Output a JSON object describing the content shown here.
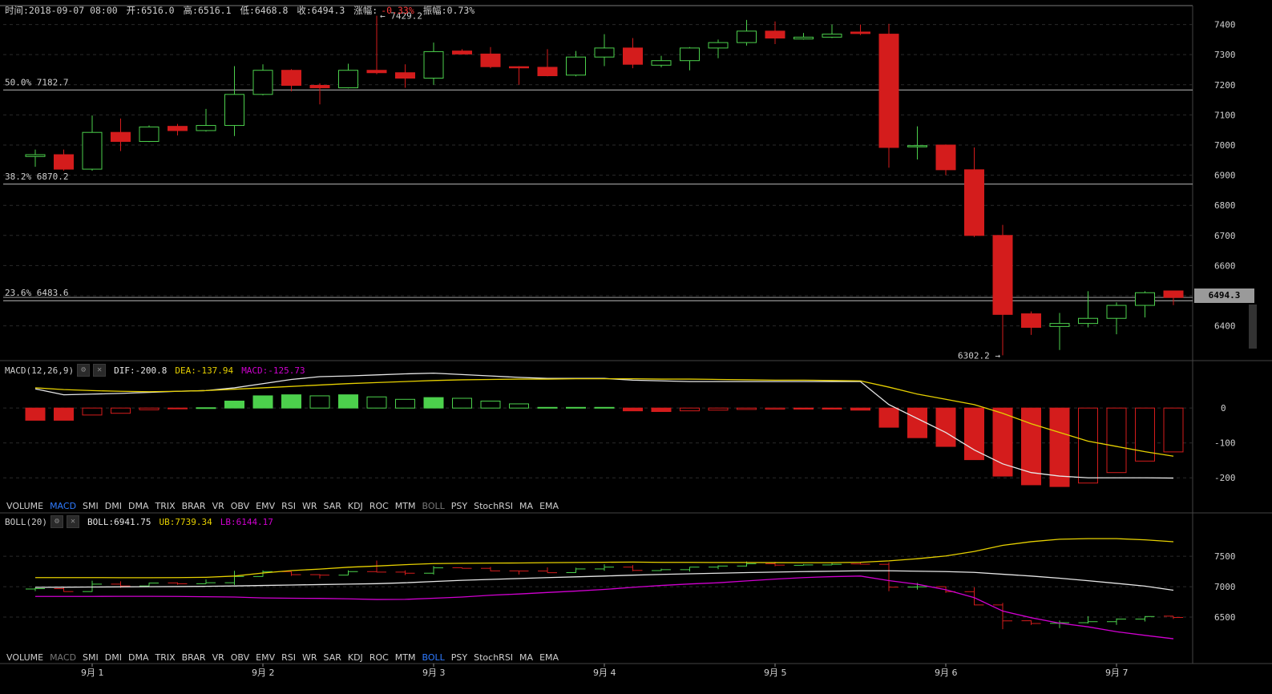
{
  "info_bar": {
    "time": "时间:2018-09-07 08:00",
    "open": "开:6516.0",
    "high": "高:6516.1",
    "low": "低:6468.8",
    "close": "收:6494.3",
    "change_label": "涨幅:",
    "change_value": "-0.33%",
    "amplitude": "振幅:0.73%"
  },
  "current_price": "6494.3",
  "fib_levels": [
    {
      "label": "50.0% 7182.7",
      "value": 7182.7
    },
    {
      "label": "38.2% 6870.2",
      "value": 6870.2
    },
    {
      "label": "23.6% 6483.6",
      "value": 6483.6
    }
  ],
  "annotations": {
    "high_label": "← 7429.2",
    "high_value": 7429.2,
    "low_label": "6302.2 →",
    "low_value": 6302.2
  },
  "macd_header": {
    "name": "MACD(12,26,9)",
    "dif": "DIF:-200.8",
    "dea": "DEA:-137.94",
    "macd": "MACD:-125.73"
  },
  "boll_header": {
    "name": "BOLL(20)",
    "boll": "BOLL:6941.75",
    "ub": "UB:7739.34",
    "lb": "LB:6144.17"
  },
  "indicator_tabs": [
    "VOLUME",
    "MACD",
    "SMI",
    "DMI",
    "DMA",
    "TRIX",
    "BRAR",
    "VR",
    "OBV",
    "EMV",
    "RSI",
    "WR",
    "SAR",
    "KDJ",
    "ROC",
    "MTM",
    "BOLL",
    "PSY",
    "StochRSI",
    "MA",
    "EMA"
  ],
  "tabs_top": {
    "active": "MACD",
    "dim": "BOLL"
  },
  "tabs_bottom": {
    "active": "BOLL",
    "dim": "MACD"
  },
  "x_labels": [
    "9月 1",
    "9月 2",
    "9月 3",
    "9月 4",
    "9月 5",
    "9月 6",
    "9月 7"
  ],
  "colors": {
    "up": "#4cd04c",
    "down": "#d41c1c",
    "dif": "#e6e6e6",
    "dea": "#e6d000",
    "macd": "#d000d0",
    "grid": "#2a2a2a"
  },
  "chart_data": [
    {
      "type": "candlestick",
      "y_ticks": [
        6400,
        6500,
        6600,
        6700,
        6800,
        6900,
        7000,
        7100,
        7200,
        7300,
        7400
      ],
      "ylim": [
        6290,
        7460
      ],
      "candles": [
        {
          "o": 6962,
          "h": 6985,
          "l": 6928,
          "c": 6968
        },
        {
          "o": 6968,
          "h": 6985,
          "l": 6915,
          "c": 6920
        },
        {
          "o": 6920,
          "h": 7098,
          "l": 6915,
          "c": 7042
        },
        {
          "o": 7042,
          "h": 7088,
          "l": 6980,
          "c": 7012
        },
        {
          "o": 7012,
          "h": 7065,
          "l": 7010,
          "c": 7060
        },
        {
          "o": 7062,
          "h": 7070,
          "l": 7032,
          "c": 7048
        },
        {
          "o": 7048,
          "h": 7120,
          "l": 7045,
          "c": 7065
        },
        {
          "o": 7065,
          "h": 7262,
          "l": 7030,
          "c": 7168
        },
        {
          "o": 7168,
          "h": 7268,
          "l": 7165,
          "c": 7248
        },
        {
          "o": 7248,
          "h": 7252,
          "l": 7178,
          "c": 7198
        },
        {
          "o": 7198,
          "h": 7205,
          "l": 7135,
          "c": 7190
        },
        {
          "o": 7190,
          "h": 7270,
          "l": 7188,
          "c": 7248
        },
        {
          "o": 7248,
          "h": 7429.2,
          "l": 7235,
          "c": 7240
        },
        {
          "o": 7240,
          "h": 7268,
          "l": 7190,
          "c": 7222
        },
        {
          "o": 7222,
          "h": 7340,
          "l": 7200,
          "c": 7310
        },
        {
          "o": 7312,
          "h": 7318,
          "l": 7300,
          "c": 7302
        },
        {
          "o": 7302,
          "h": 7325,
          "l": 7255,
          "c": 7260
        },
        {
          "o": 7260,
          "h": 7262,
          "l": 7200,
          "c": 7258
        },
        {
          "o": 7258,
          "h": 7318,
          "l": 7228,
          "c": 7230
        },
        {
          "o": 7232,
          "h": 7312,
          "l": 7228,
          "c": 7292
        },
        {
          "o": 7292,
          "h": 7368,
          "l": 7262,
          "c": 7322
        },
        {
          "o": 7322,
          "h": 7355,
          "l": 7255,
          "c": 7268
        },
        {
          "o": 7265,
          "h": 7296,
          "l": 7258,
          "c": 7280
        },
        {
          "o": 7280,
          "h": 7325,
          "l": 7248,
          "c": 7322
        },
        {
          "o": 7322,
          "h": 7350,
          "l": 7288,
          "c": 7340
        },
        {
          "o": 7340,
          "h": 7415,
          "l": 7330,
          "c": 7378
        },
        {
          "o": 7378,
          "h": 7410,
          "l": 7335,
          "c": 7355
        },
        {
          "o": 7352,
          "h": 7372,
          "l": 7350,
          "c": 7358
        },
        {
          "o": 7358,
          "h": 7400,
          "l": 7355,
          "c": 7368
        },
        {
          "o": 7375,
          "h": 7400,
          "l": 7365,
          "c": 7370
        },
        {
          "o": 7368,
          "h": 7402,
          "l": 6925,
          "c": 6992
        },
        {
          "o": 6994,
          "h": 7062,
          "l": 6952,
          "c": 6998
        },
        {
          "o": 7000,
          "h": 7002,
          "l": 6900,
          "c": 6918
        },
        {
          "o": 6918,
          "h": 6992,
          "l": 6695,
          "c": 6700
        },
        {
          "o": 6700,
          "h": 6735,
          "l": 6302.2,
          "c": 6438
        },
        {
          "o": 6440,
          "h": 6448,
          "l": 6370,
          "c": 6395
        },
        {
          "o": 6398,
          "h": 6443,
          "l": 6320,
          "c": 6408
        },
        {
          "o": 6408,
          "h": 6515,
          "l": 6395,
          "c": 6425
        },
        {
          "o": 6425,
          "h": 6478,
          "l": 6372,
          "c": 6468
        },
        {
          "o": 6468,
          "h": 6515,
          "l": 6428,
          "c": 6510
        },
        {
          "o": 6516,
          "h": 6516.1,
          "l": 6468.8,
          "c": 6494.3
        }
      ]
    },
    {
      "type": "macd",
      "y_ticks": [
        0,
        -100,
        -200
      ],
      "ylim": [
        -250,
        90
      ],
      "hist": [
        -35,
        -35,
        -20,
        -15,
        -5,
        -2,
        1,
        20,
        35,
        38,
        35,
        38,
        32,
        25,
        30,
        28,
        20,
        12,
        2,
        2,
        2,
        -8,
        -10,
        -8,
        -6,
        -4,
        -3,
        -3,
        -3,
        -6,
        -55,
        -85,
        -110,
        -148,
        -195,
        -220,
        -225,
        -215,
        -185,
        -152,
        -125.73
      ],
      "dif": [
        55,
        38,
        40,
        42,
        45,
        48,
        50,
        58,
        70,
        82,
        90,
        92,
        95,
        98,
        100,
        96,
        92,
        88,
        85,
        85,
        85,
        80,
        78,
        76,
        76,
        76,
        76,
        76,
        76,
        76,
        10,
        -30,
        -70,
        -120,
        -160,
        -185,
        -195,
        -200,
        -200,
        -200,
        -200.8
      ],
      "dea": [
        58,
        53,
        50,
        48,
        47,
        48,
        50,
        54,
        58,
        62,
        66,
        70,
        73,
        76,
        79,
        81,
        82,
        83,
        83,
        84,
        84,
        84,
        83,
        83,
        82,
        81,
        80,
        80,
        79,
        78,
        60,
        40,
        25,
        10,
        -15,
        -45,
        -70,
        -95,
        -110,
        -125,
        -137.94
      ]
    },
    {
      "type": "boll",
      "y_ticks": [
        6500,
        7000,
        7500
      ],
      "ylim": [
        6000,
        7950
      ],
      "mid": [
        6990,
        6992,
        6995,
        6997,
        7000,
        7002,
        7006,
        7012,
        7020,
        7028,
        7035,
        7043,
        7050,
        7065,
        7085,
        7105,
        7120,
        7135,
        7150,
        7162,
        7175,
        7190,
        7202,
        7212,
        7222,
        7232,
        7240,
        7248,
        7255,
        7262,
        7262,
        7255,
        7248,
        7235,
        7205,
        7175,
        7140,
        7098,
        7055,
        7010,
        6941.75
      ],
      "ub": [
        7150,
        7150,
        7150,
        7148,
        7148,
        7150,
        7155,
        7175,
        7225,
        7265,
        7290,
        7320,
        7340,
        7362,
        7380,
        7385,
        7388,
        7390,
        7395,
        7398,
        7402,
        7405,
        7400,
        7400,
        7398,
        7398,
        7396,
        7395,
        7395,
        7402,
        7425,
        7460,
        7505,
        7580,
        7680,
        7740,
        7780,
        7790,
        7790,
        7770,
        7739.34
      ],
      "lb": [
        6840,
        6840,
        6840,
        6842,
        6842,
        6840,
        6835,
        6830,
        6815,
        6810,
        6808,
        6800,
        6790,
        6792,
        6810,
        6830,
        6860,
        6880,
        6905,
        6928,
        6955,
        6990,
        7020,
        7045,
        7065,
        7095,
        7125,
        7150,
        7165,
        7175,
        7100,
        7040,
        6950,
        6820,
        6600,
        6490,
        6400,
        6340,
        6260,
        6200,
        6144.17
      ]
    }
  ]
}
